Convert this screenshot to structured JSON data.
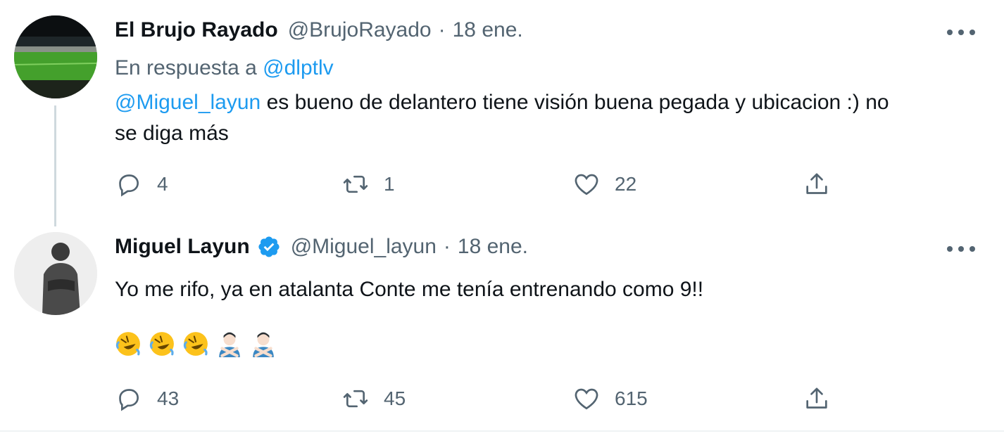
{
  "tweets": [
    {
      "display_name": "El Brujo Rayado",
      "handle": "@BrujoRayado",
      "separator": "·",
      "date": "18 ene.",
      "reply_prefix": "En respuesta a",
      "reply_to": "@dlptlv",
      "mention": "@Miguel_layun",
      "text_rest": " es bueno de delantero tiene visión buena pegada y ubicacion :) no se diga más",
      "replies": "4",
      "retweets": "1",
      "likes": "22",
      "avatar": "stadium-avatar"
    },
    {
      "display_name": "Miguel Layun",
      "verified": true,
      "handle": "@Miguel_layun",
      "separator": "·",
      "date": "18 ene.",
      "text": "Yo me rifo, ya en atalanta Conte me tenía entrenando como 9!!",
      "emojis": [
        "rolling-on-floor-laughing",
        "rolling-on-floor-laughing",
        "rolling-on-floor-laughing",
        "man-gesturing-no",
        "man-gesturing-no"
      ],
      "replies": "43",
      "retweets": "45",
      "likes": "615",
      "avatar": "person-avatar"
    }
  ],
  "colors": {
    "link": "#1d9bf0",
    "secondary": "#536471",
    "thread_line": "#cfd9de"
  }
}
